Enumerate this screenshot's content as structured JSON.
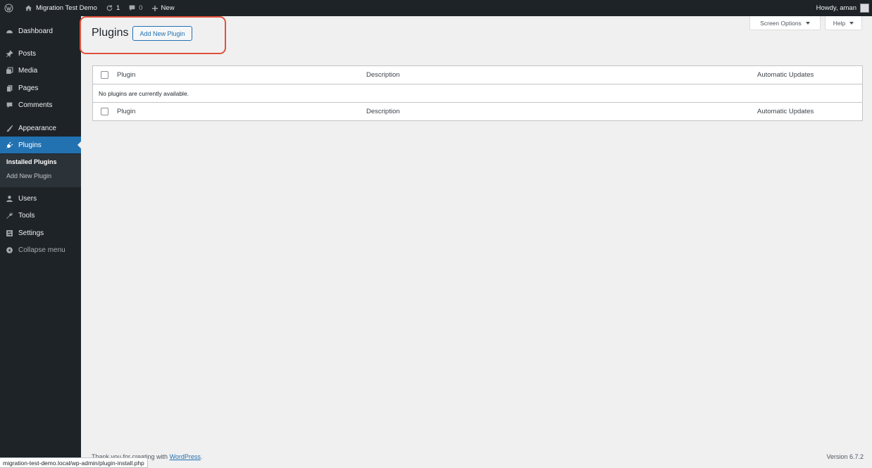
{
  "admin_bar": {
    "site_name": "Migration Test Demo",
    "updates_count": "1",
    "comments_count": "0",
    "new_label": "New",
    "greeting": "Howdy, aman"
  },
  "sidebar": {
    "items": [
      {
        "label": "Dashboard",
        "icon": "dashboard-icon"
      },
      {
        "label": "Posts",
        "icon": "pin-icon"
      },
      {
        "label": "Media",
        "icon": "media-icon"
      },
      {
        "label": "Pages",
        "icon": "pages-icon"
      },
      {
        "label": "Comments",
        "icon": "comments-icon"
      },
      {
        "label": "Appearance",
        "icon": "brush-icon"
      },
      {
        "label": "Plugins",
        "icon": "plugin-icon"
      },
      {
        "label": "Users",
        "icon": "users-icon"
      },
      {
        "label": "Tools",
        "icon": "wrench-icon"
      },
      {
        "label": "Settings",
        "icon": "settings-icon"
      },
      {
        "label": "Collapse menu",
        "icon": "collapse-icon"
      }
    ],
    "submenu": {
      "installed": "Installed Plugins",
      "add_new": "Add New Plugin"
    }
  },
  "main": {
    "title": "Plugins",
    "add_new_button": "Add New Plugin",
    "screen_options": "Screen Options",
    "help": "Help",
    "table": {
      "columns": [
        "Plugin",
        "Description",
        "Automatic Updates"
      ],
      "empty_message": "No plugins are currently available."
    }
  },
  "footer": {
    "credit_prefix": "Thank you for creating with ",
    "credit_link": "WordPress",
    "credit_suffix": ".",
    "version": "Version 6.7.2"
  },
  "status_bar": {
    "url": "migration-test-demo.local/wp-admin/plugin-install.php"
  },
  "colors": {
    "admin_bar_bg": "#1d2327",
    "accent": "#2271b1",
    "highlight": "#e0523b",
    "page_bg": "#f0f0f1"
  }
}
